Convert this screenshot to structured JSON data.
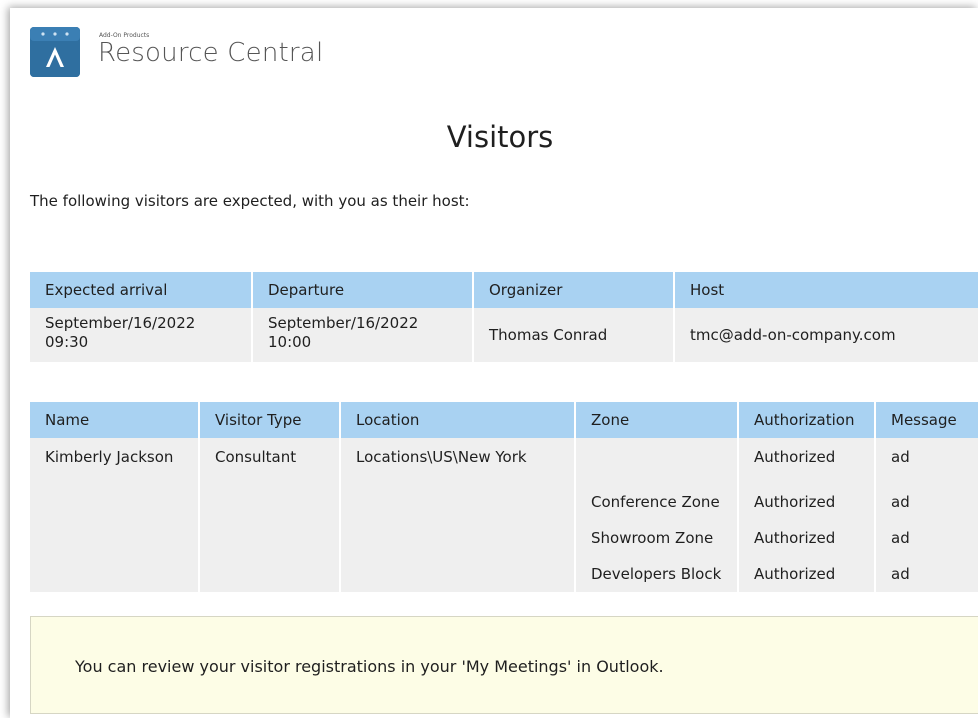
{
  "brand": {
    "small_text": "Add-On Products",
    "title": "Resource Central",
    "logo_icon": "resource-central-logo-icon"
  },
  "page": {
    "title": "Visitors",
    "intro": "The following visitors are expected, with you as their host:"
  },
  "meeting_table": {
    "headers": [
      "Expected arrival",
      "Departure",
      "Organizer",
      "Host"
    ],
    "row": {
      "arrival_date": "September/16/2022",
      "arrival_time": "09:30",
      "departure_date": "September/16/2022",
      "departure_time": "10:00",
      "organizer": "Thomas Conrad",
      "host": "tmc@add-on-company.com"
    }
  },
  "visitor_table": {
    "headers": [
      "Name",
      "Visitor Type",
      "Location",
      "Zone",
      "Authorization",
      "Message"
    ],
    "visitor": {
      "name": "Kimberly Jackson",
      "type": "Consultant",
      "location": "Locations\\US\\New York"
    },
    "zones": [
      {
        "zone": "",
        "authorization": "Authorized",
        "message": "ad"
      },
      {
        "zone": "Conference Zone",
        "authorization": "Authorized",
        "message": "ad"
      },
      {
        "zone": "Showroom Zone",
        "authorization": "Authorized",
        "message": "ad"
      },
      {
        "zone": "Developers Block",
        "authorization": "Authorized",
        "message": "ad"
      }
    ]
  },
  "notice": {
    "text": "You can review your visitor registrations in your 'My Meetings' in Outlook."
  },
  "colors": {
    "header_blue": "#a9d2f2",
    "row_gray": "#efefef",
    "notice_bg": "#fdfde6",
    "logo_blue": "#2f6fa0"
  }
}
